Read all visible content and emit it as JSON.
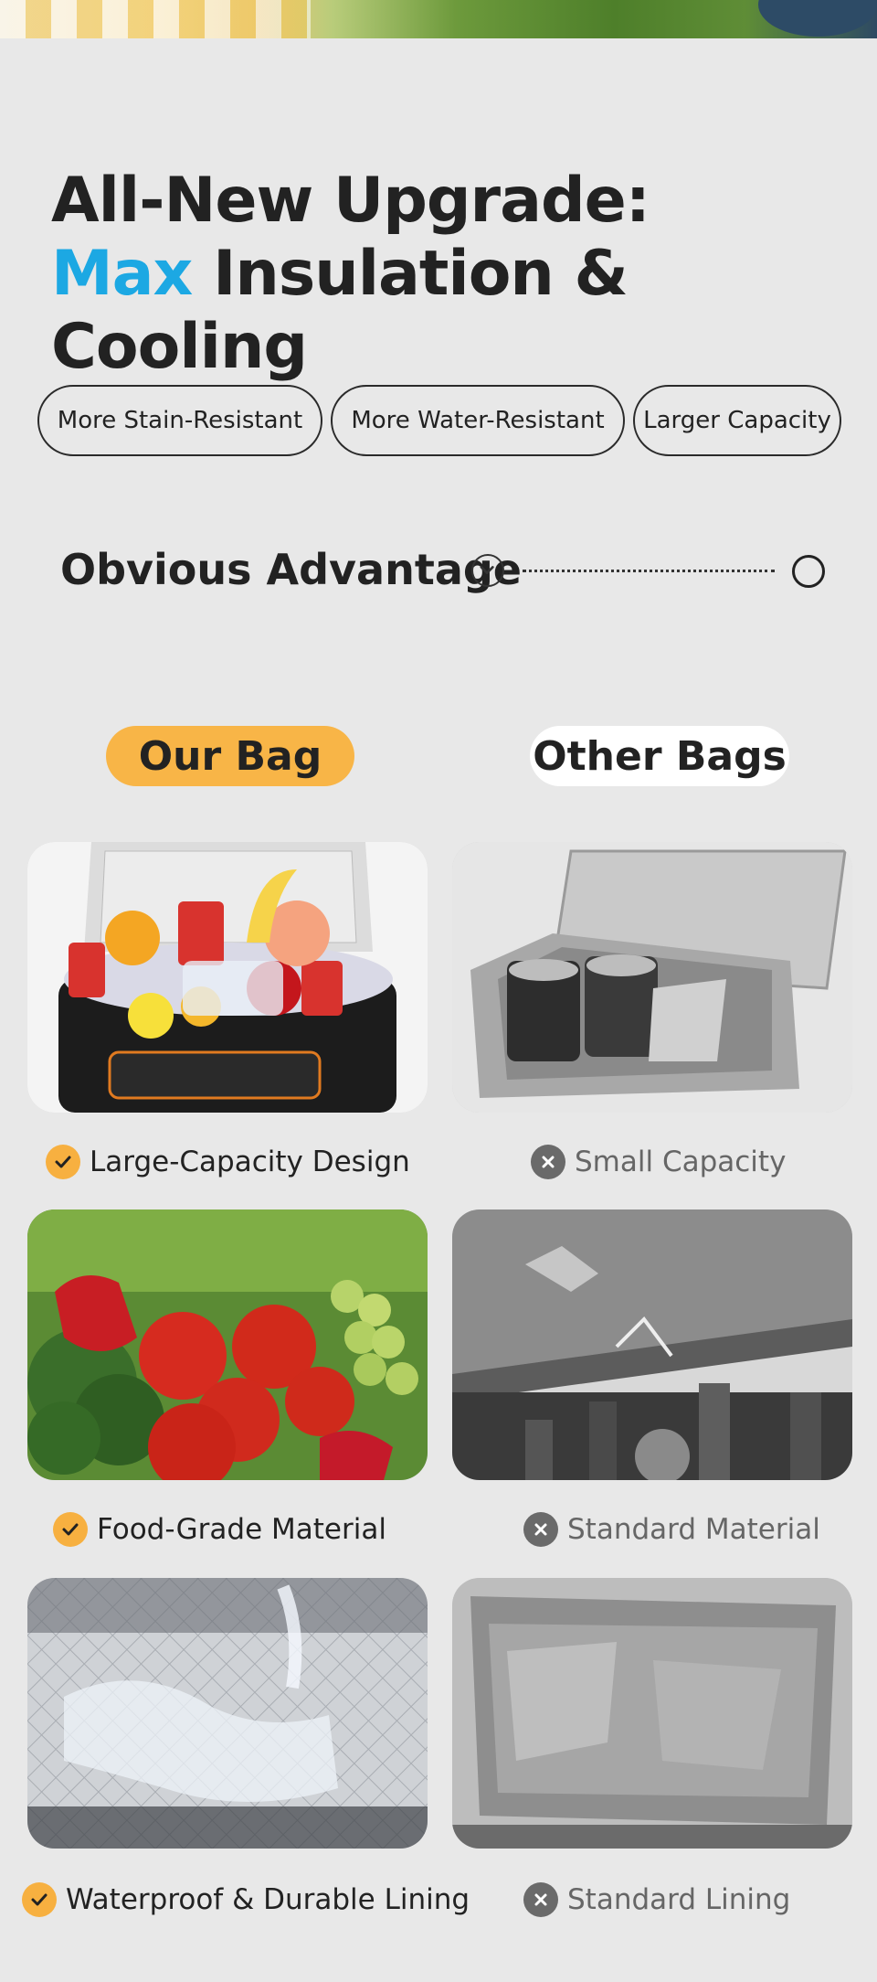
{
  "headline": {
    "line1": "All-New Upgrade:",
    "line2_accent": "Max",
    "line2_rest": " Insulation & Cooling",
    "accent_color": "#1ca8e3"
  },
  "features": [
    "More Stain-Resistant",
    "More Water-Resistant",
    "Larger Capacity"
  ],
  "advantage": {
    "title": "Obvious Advantage",
    "icon": "chevron-down-circle-icon"
  },
  "comparison": {
    "ours_label": "Our Bag",
    "others_label": "Other Bags",
    "ours_color": "#f8b547",
    "rows": [
      {
        "ours": "Large-Capacity Design",
        "others": "Small Capacity"
      },
      {
        "ours": "Food-Grade Material",
        "others": "Standard Material"
      },
      {
        "ours": "Waterproof & Durable Lining",
        "others": "Standard Lining"
      }
    ]
  }
}
